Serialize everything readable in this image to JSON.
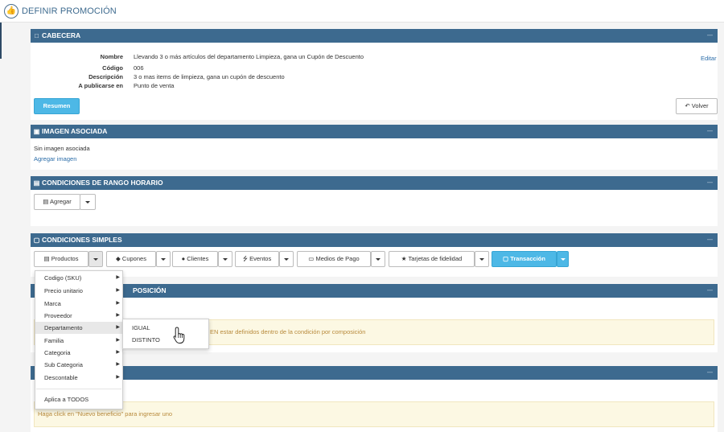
{
  "header": {
    "title": "DEFINIR PROMOCIÓN",
    "icon": "thumbs-up-icon"
  },
  "cabecera": {
    "title": "CABECERA",
    "fields": [
      {
        "label": "Nombre",
        "value": "Llevando 3 o más artículos del departamento Limpieza, gana un Cupón de Descuento"
      },
      {
        "label": "Código",
        "value": "006"
      },
      {
        "label": "Descripción",
        "value": "3 o mas items de limpieza, gana un cupón de descuento"
      },
      {
        "label": "A publicarse en",
        "value": "Punto de venta"
      }
    ],
    "edit_label": "Editar",
    "resumen_label": "Resumen",
    "volver_label": "Volver"
  },
  "imagen": {
    "title": "IMAGEN ASOCIADA",
    "empty_text": "Sin imagen asociada",
    "add_label": "Agregar imagen"
  },
  "horario": {
    "title": "CONDICIONES DE RANGO HORARIO",
    "add_label": "Agregar"
  },
  "simples": {
    "title": "CONDICIONES SIMPLES",
    "buttons": [
      {
        "label": "Productos"
      },
      {
        "label": "Cupones"
      },
      {
        "label": "Clientes"
      },
      {
        "label": "Eventos"
      },
      {
        "label": "Medios de Pago"
      },
      {
        "label": "Tarjetas de fidelidad"
      },
      {
        "label": "Transacción"
      }
    ]
  },
  "composicion": {
    "title_visible": "POSICIÓN",
    "warning_visible": "EN estar definidos dentro de la condición por composición"
  },
  "beneficios": {
    "warning": "Haga click en \"Nuevo beneficio\" para ingresar uno"
  },
  "dropdown": {
    "items": [
      {
        "label": "Codigo (SKU)"
      },
      {
        "label": "Precio unitario"
      },
      {
        "label": "Marca"
      },
      {
        "label": "Proveedor"
      },
      {
        "label": "Departamento"
      },
      {
        "label": "Familia"
      },
      {
        "label": "Categoria"
      },
      {
        "label": "Sub Categoria"
      },
      {
        "label": "Descontable"
      }
    ],
    "footer_item": "Aplica a TODOS",
    "submenu": [
      {
        "label": "IGUAL"
      },
      {
        "label": "DISTINTO"
      }
    ]
  },
  "colors": {
    "panel_header": "#3d6a8f",
    "accent": "#4db8e6",
    "link": "#2a6ca8",
    "warning_bg": "#fcf8e3"
  }
}
